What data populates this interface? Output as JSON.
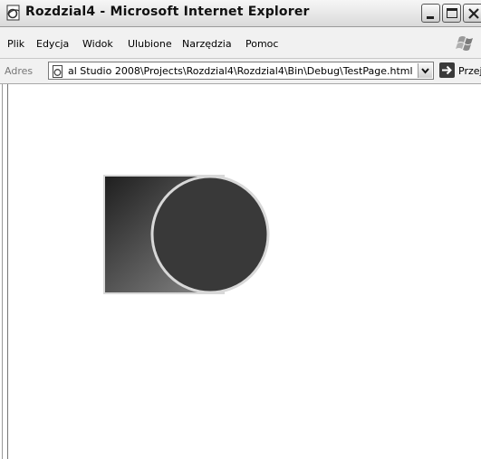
{
  "window": {
    "title": "Rozdzial4 - Microsoft Internet Explorer"
  },
  "menu": {
    "items": [
      "Plik",
      "Edycja",
      "Widok",
      "Ulubione",
      "Narzędzia",
      "Pomoc"
    ]
  },
  "address_bar": {
    "label": "Adres",
    "value": "al Studio 2008\\Projects\\Rozdzial4\\Rozdzial4\\Bin\\Debug\\TestPage.html",
    "go_label": "Przejdź"
  },
  "icons": [
    "ie-page-icon",
    "minimize-icon",
    "maximize-icon",
    "close-icon",
    "windows-logo-icon",
    "page-icon",
    "chevron-down-icon",
    "go-arrow-icon"
  ],
  "content": {
    "shape_colors": {
      "rect_gradient_start": "#1e1e1e",
      "rect_gradient_end": "#8a8a8a",
      "circle_fill": "#393939",
      "stroke": "#d8d8d8"
    }
  }
}
